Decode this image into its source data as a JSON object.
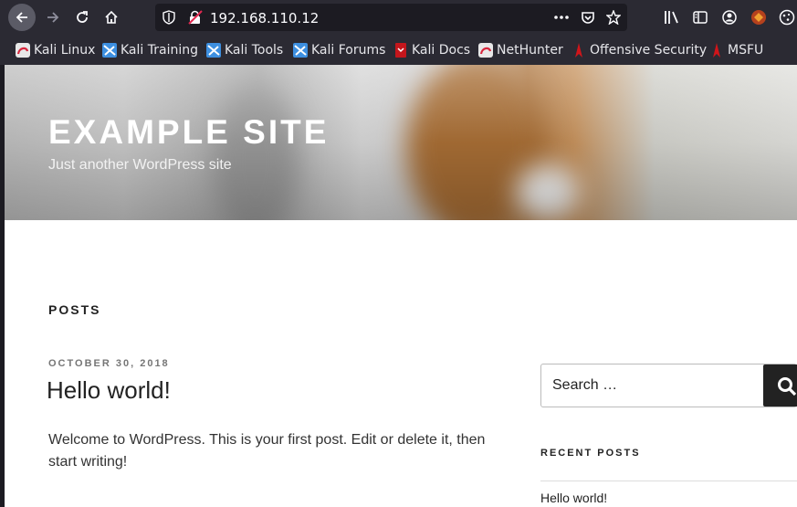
{
  "browser": {
    "url": "192.168.110.12",
    "bookmarks": [
      {
        "label": "Kali Linux",
        "icon": "kali-dragon-icon"
      },
      {
        "label": "Kali Training",
        "icon": "kali-training-icon"
      },
      {
        "label": "Kali Tools",
        "icon": "kali-tools-icon"
      },
      {
        "label": "Kali Forums",
        "icon": "kali-forums-icon"
      },
      {
        "label": "Kali Docs",
        "icon": "kali-docs-icon"
      },
      {
        "label": "NetHunter",
        "icon": "nethunter-icon"
      },
      {
        "label": "Offensive Security",
        "icon": "offsec-icon"
      },
      {
        "label": "MSFU",
        "icon": "msfu-icon"
      }
    ]
  },
  "site": {
    "title": "EXAMPLE SITE",
    "tagline": "Just another WordPress site"
  },
  "main": {
    "section_heading": "POSTS",
    "post": {
      "date": "OCTOBER 30, 2018",
      "title": "Hello world!",
      "excerpt": "Welcome to WordPress. This is your first post. Edit or delete it, then start writing!"
    }
  },
  "sidebar": {
    "search_placeholder": "Search …",
    "recent_posts_heading": "RECENT POSTS",
    "recent_posts": [
      "Hello world!"
    ]
  },
  "colors": {
    "toolbar": "#2b2a33",
    "urlbar": "#1c1b22",
    "text_dark": "#222222",
    "meta_gray": "#767676"
  }
}
